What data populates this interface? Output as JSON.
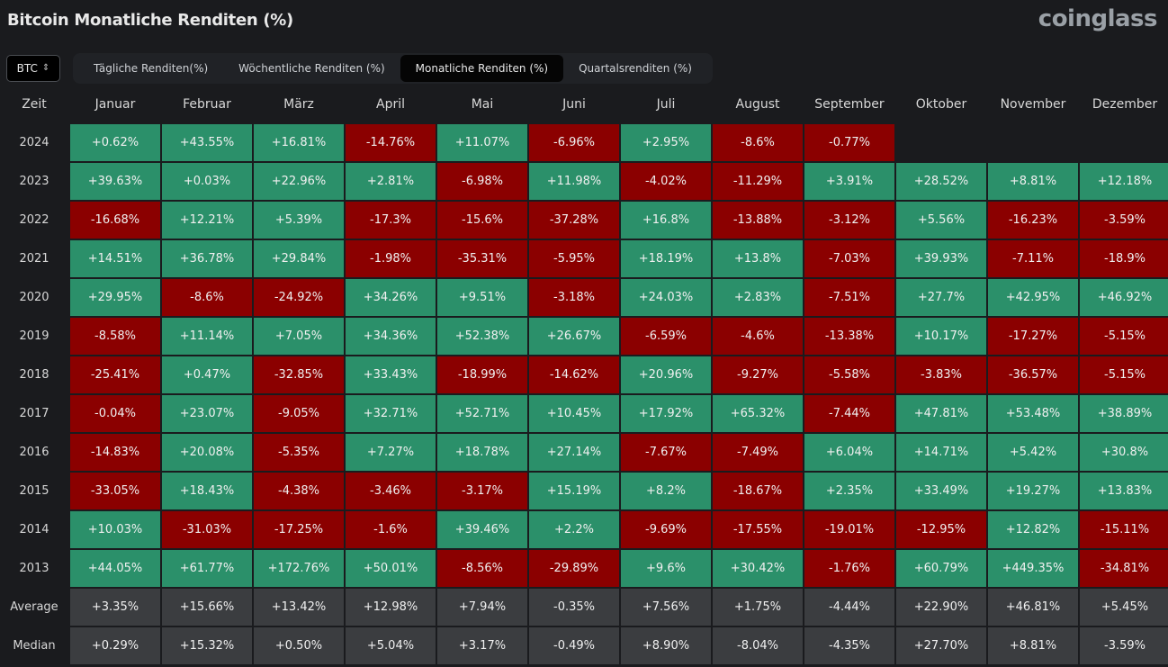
{
  "header": {
    "title": "Bitcoin Monatliche Renditen (%)",
    "brand": "coinglass"
  },
  "toolbar": {
    "coin_select": {
      "value": "BTC",
      "icon": "chevron-updown-icon"
    },
    "tabs": [
      {
        "label": "Tägliche Renditen(%)",
        "active": false
      },
      {
        "label": "Wöchentliche Renditen (%)",
        "active": false
      },
      {
        "label": "Monatliche Renditen (%)",
        "active": true
      },
      {
        "label": "Quartalsrenditen (%)",
        "active": false
      }
    ]
  },
  "colors": {
    "positive": "#2b906a",
    "negative": "#8b0000",
    "stat": "#3b3d40",
    "background": "#1a1b1e"
  },
  "chart_data": {
    "type": "heatmap",
    "title": "Bitcoin Monatliche Renditen (%)",
    "row_header": "Zeit",
    "columns": [
      "Januar",
      "Februar",
      "März",
      "April",
      "Mai",
      "Juni",
      "Juli",
      "August",
      "September",
      "Oktober",
      "November",
      "Dezember"
    ],
    "rows": [
      {
        "label": "2024",
        "values": [
          "+0.62%",
          "+43.55%",
          "+16.81%",
          "-14.76%",
          "+11.07%",
          "-6.96%",
          "+2.95%",
          "-8.6%",
          "-0.77%",
          "",
          "",
          ""
        ]
      },
      {
        "label": "2023",
        "values": [
          "+39.63%",
          "+0.03%",
          "+22.96%",
          "+2.81%",
          "-6.98%",
          "+11.98%",
          "-4.02%",
          "-11.29%",
          "+3.91%",
          "+28.52%",
          "+8.81%",
          "+12.18%"
        ]
      },
      {
        "label": "2022",
        "values": [
          "-16.68%",
          "+12.21%",
          "+5.39%",
          "-17.3%",
          "-15.6%",
          "-37.28%",
          "+16.8%",
          "-13.88%",
          "-3.12%",
          "+5.56%",
          "-16.23%",
          "-3.59%"
        ]
      },
      {
        "label": "2021",
        "values": [
          "+14.51%",
          "+36.78%",
          "+29.84%",
          "-1.98%",
          "-35.31%",
          "-5.95%",
          "+18.19%",
          "+13.8%",
          "-7.03%",
          "+39.93%",
          "-7.11%",
          "-18.9%"
        ]
      },
      {
        "label": "2020",
        "values": [
          "+29.95%",
          "-8.6%",
          "-24.92%",
          "+34.26%",
          "+9.51%",
          "-3.18%",
          "+24.03%",
          "+2.83%",
          "-7.51%",
          "+27.7%",
          "+42.95%",
          "+46.92%"
        ]
      },
      {
        "label": "2019",
        "values": [
          "-8.58%",
          "+11.14%",
          "+7.05%",
          "+34.36%",
          "+52.38%",
          "+26.67%",
          "-6.59%",
          "-4.6%",
          "-13.38%",
          "+10.17%",
          "-17.27%",
          "-5.15%"
        ]
      },
      {
        "label": "2018",
        "values": [
          "-25.41%",
          "+0.47%",
          "-32.85%",
          "+33.43%",
          "-18.99%",
          "-14.62%",
          "+20.96%",
          "-9.27%",
          "-5.58%",
          "-3.83%",
          "-36.57%",
          "-5.15%"
        ]
      },
      {
        "label": "2017",
        "values": [
          "-0.04%",
          "+23.07%",
          "-9.05%",
          "+32.71%",
          "+52.71%",
          "+10.45%",
          "+17.92%",
          "+65.32%",
          "-7.44%",
          "+47.81%",
          "+53.48%",
          "+38.89%"
        ]
      },
      {
        "label": "2016",
        "values": [
          "-14.83%",
          "+20.08%",
          "-5.35%",
          "+7.27%",
          "+18.78%",
          "+27.14%",
          "-7.67%",
          "-7.49%",
          "+6.04%",
          "+14.71%",
          "+5.42%",
          "+30.8%"
        ]
      },
      {
        "label": "2015",
        "values": [
          "-33.05%",
          "+18.43%",
          "-4.38%",
          "-3.46%",
          "-3.17%",
          "+15.19%",
          "+8.2%",
          "-18.67%",
          "+2.35%",
          "+33.49%",
          "+19.27%",
          "+13.83%"
        ]
      },
      {
        "label": "2014",
        "values": [
          "+10.03%",
          "-31.03%",
          "-17.25%",
          "-1.6%",
          "+39.46%",
          "+2.2%",
          "-9.69%",
          "-17.55%",
          "-19.01%",
          "-12.95%",
          "+12.82%",
          "-15.11%"
        ]
      },
      {
        "label": "2013",
        "values": [
          "+44.05%",
          "+61.77%",
          "+172.76%",
          "+50.01%",
          "-8.56%",
          "-29.89%",
          "+9.6%",
          "+30.42%",
          "-1.76%",
          "+60.79%",
          "+449.35%",
          "-34.81%"
        ]
      }
    ],
    "summary_rows": [
      {
        "label": "Average",
        "values": [
          "+3.35%",
          "+15.66%",
          "+13.42%",
          "+12.98%",
          "+7.94%",
          "-0.35%",
          "+7.56%",
          "+1.75%",
          "-4.44%",
          "+22.90%",
          "+46.81%",
          "+5.45%"
        ]
      },
      {
        "label": "Median",
        "values": [
          "+0.29%",
          "+15.32%",
          "+0.50%",
          "+5.04%",
          "+3.17%",
          "-0.49%",
          "+8.90%",
          "-8.04%",
          "-4.35%",
          "+27.70%",
          "+8.81%",
          "-3.59%"
        ]
      }
    ]
  }
}
